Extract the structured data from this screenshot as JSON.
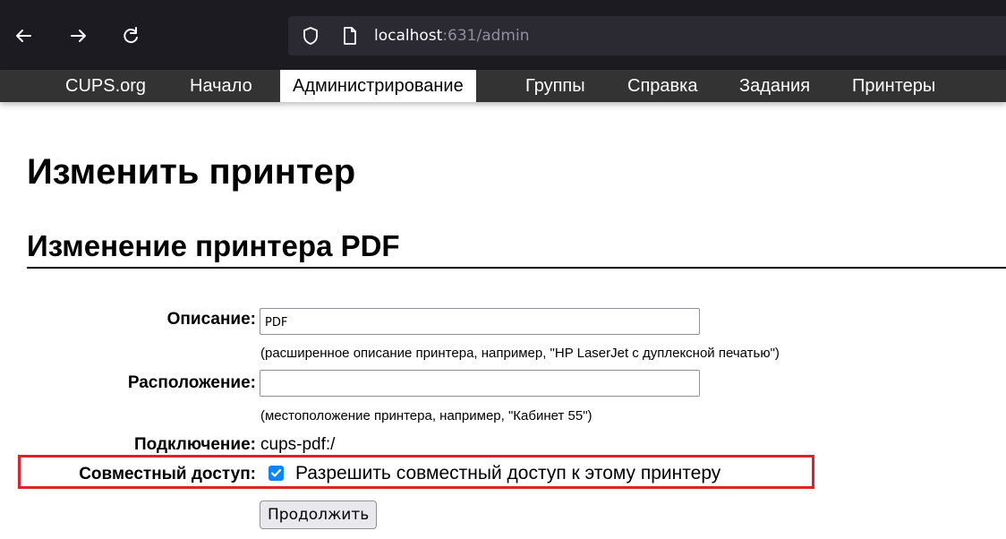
{
  "browser": {
    "url_host": "localhost",
    "url_rest": ":631/admin",
    "icons": [
      "back-arrow-icon",
      "forward-arrow-icon",
      "reload-icon",
      "shield-icon",
      "page-icon"
    ]
  },
  "nav": {
    "items": [
      {
        "label": "CUPS.org",
        "active": false
      },
      {
        "label": "Начало",
        "active": false
      },
      {
        "label": "Администрирование",
        "active": true
      },
      {
        "label": "Группы",
        "active": false
      },
      {
        "label": "Справка",
        "active": false
      },
      {
        "label": "Задания",
        "active": false
      },
      {
        "label": "Принтеры",
        "active": false
      }
    ]
  },
  "page": {
    "title": "Изменить принтер",
    "subtitle": "Изменение принтера PDF"
  },
  "form": {
    "description": {
      "label": "Описание:",
      "value": "PDF",
      "hint": "(расширенное описание принтера, например, \"HP LaserJet с дуплексной печатью\")"
    },
    "location": {
      "label": "Расположение:",
      "value": "",
      "hint": "(местоположение принтера, например, \"Кабинет 55\")"
    },
    "connection": {
      "label": "Подключение:",
      "value": "cups-pdf:/"
    },
    "sharing": {
      "label": "Совместный доступ:",
      "checkbox_label": "Разрешить совместный доступ к этому принтеру",
      "checked": true
    },
    "submit_label": "Продолжить"
  },
  "colors": {
    "highlight": "#e0202a",
    "checkbox_accent": "#0a84ff",
    "nav_bg": "#333333",
    "chrome_bg": "#1c1b22"
  }
}
